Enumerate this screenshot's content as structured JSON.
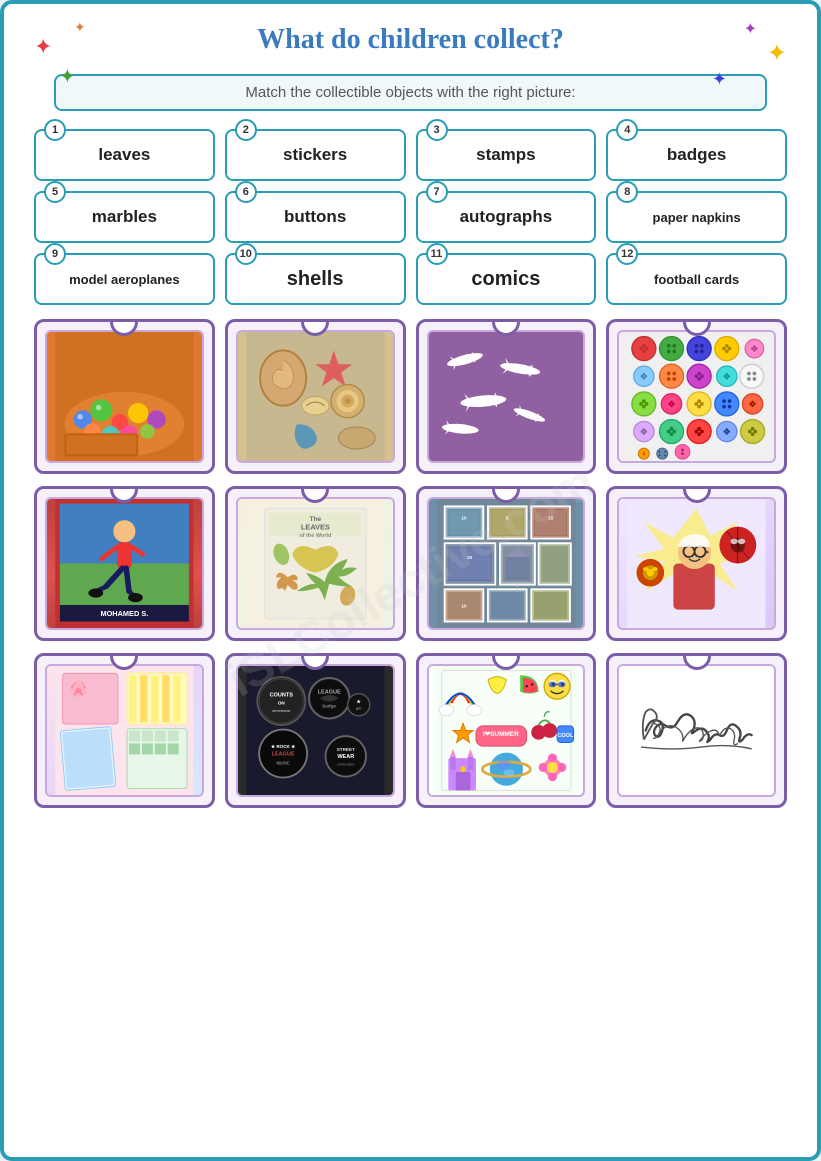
{
  "page": {
    "title": "What do children collect?",
    "instruction": "Match the collectible objects with the right picture:",
    "labels": [
      {
        "num": "1",
        "word": "leaves",
        "size": "normal"
      },
      {
        "num": "2",
        "word": "stickers",
        "size": "normal"
      },
      {
        "num": "3",
        "word": "stamps",
        "size": "normal"
      },
      {
        "num": "4",
        "word": "badges",
        "size": "normal"
      },
      {
        "num": "5",
        "word": "marbles",
        "size": "normal"
      },
      {
        "num": "6",
        "word": "buttons",
        "size": "normal"
      },
      {
        "num": "7",
        "word": "autographs",
        "size": "normal"
      },
      {
        "num": "8",
        "word": "paper napkins",
        "size": "small"
      },
      {
        "num": "9",
        "word": "model aeroplanes",
        "size": "small"
      },
      {
        "num": "10",
        "word": "shells",
        "size": "normal"
      },
      {
        "num": "11",
        "word": "comics",
        "size": "normal"
      },
      {
        "num": "12",
        "word": "football cards",
        "size": "normal"
      }
    ],
    "images": [
      {
        "id": "img1",
        "type": "marbles"
      },
      {
        "id": "img2",
        "type": "shells"
      },
      {
        "id": "img3",
        "type": "aeroplanes"
      },
      {
        "id": "img4",
        "type": "buttons"
      },
      {
        "id": "img5",
        "type": "football"
      },
      {
        "id": "img6",
        "type": "leaves"
      },
      {
        "id": "img7",
        "type": "stamps"
      },
      {
        "id": "img8",
        "type": "comics"
      },
      {
        "id": "img9",
        "type": "napkins"
      },
      {
        "id": "img10",
        "type": "badges"
      },
      {
        "id": "img11",
        "type": "stickers"
      },
      {
        "id": "img12",
        "type": "autograph"
      }
    ],
    "watermark": "iSLCollective.com",
    "colors": {
      "border": "#2a9db5",
      "purple": "#7b5ea7",
      "title": "#3a7bbf"
    },
    "stars": [
      {
        "color": "#e84040",
        "symbol": "✦"
      },
      {
        "color": "#a040c0",
        "symbol": "✦"
      },
      {
        "color": "#f0c000",
        "symbol": "✦"
      },
      {
        "color": "#40a040",
        "symbol": "✦"
      },
      {
        "color": "#4040e0",
        "symbol": "✦"
      },
      {
        "color": "#e08040",
        "symbol": "✦"
      },
      {
        "color": "#e84040",
        "symbol": "✦"
      },
      {
        "color": "#f0c000",
        "symbol": "✦"
      }
    ]
  }
}
